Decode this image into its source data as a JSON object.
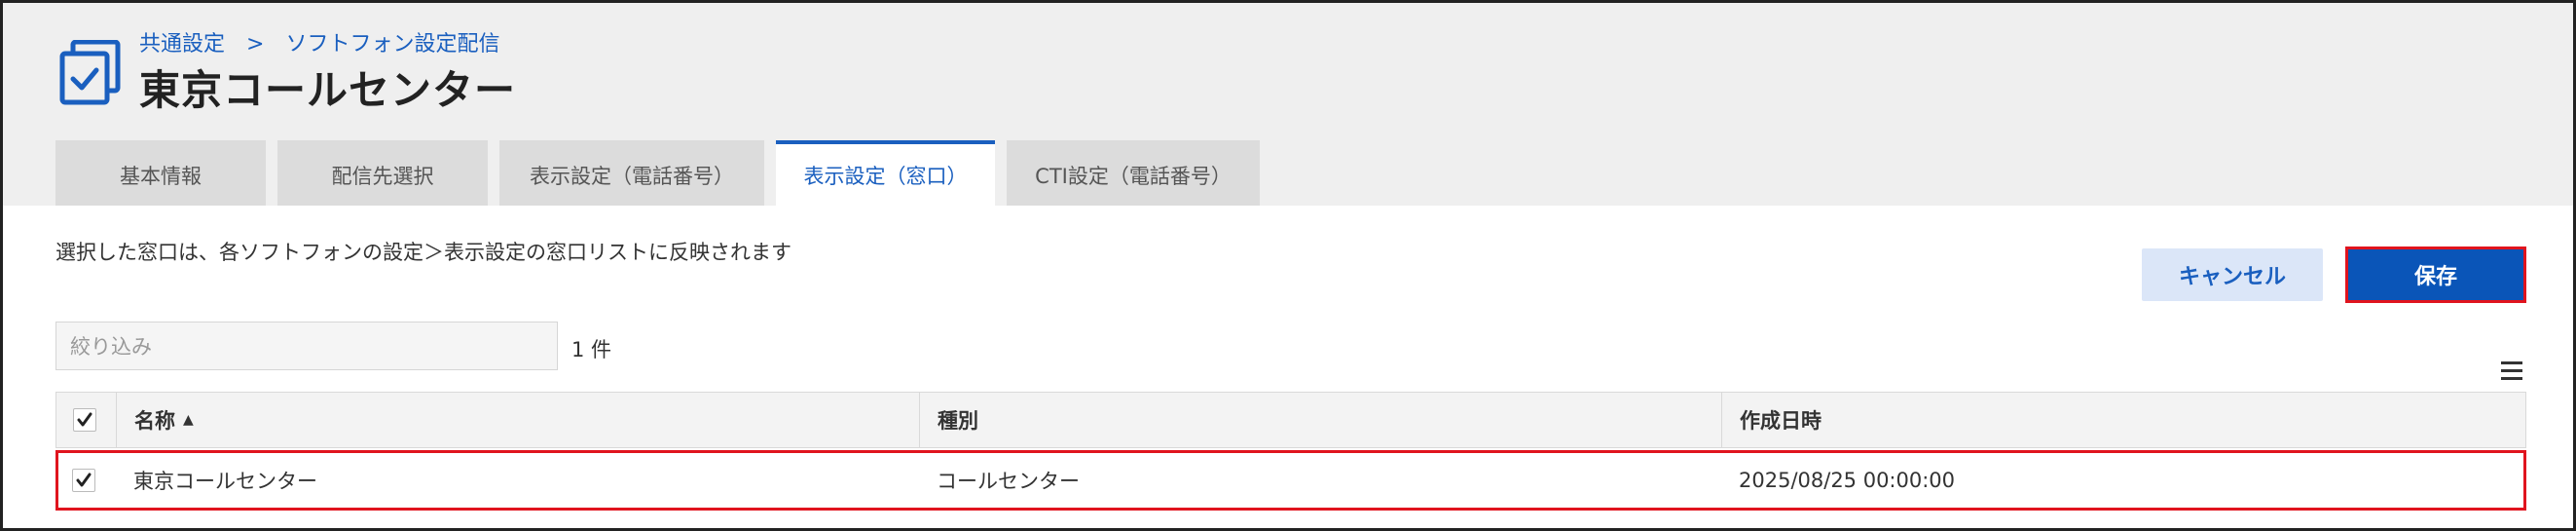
{
  "header": {
    "breadcrumb": {
      "parent": "共通設定",
      "separator": ">",
      "current": "ソフトフォン設定配信"
    },
    "title": "東京コールセンター",
    "icon": "clipboard-check-icon"
  },
  "tabs": [
    {
      "label": "基本情報",
      "active": false
    },
    {
      "label": "配信先選択",
      "active": false
    },
    {
      "label": "表示設定（電話番号）",
      "active": false
    },
    {
      "label": "表示設定（窓口）",
      "active": true
    },
    {
      "label": "CTI設定（電話番号）",
      "active": false
    }
  ],
  "content": {
    "description": "選択した窓口は、各ソフトフォンの設定＞表示設定の窓口リストに反映されます",
    "cancel_label": "キャンセル",
    "save_label": "保存",
    "filter_placeholder": "絞り込み",
    "count_text": "1 件"
  },
  "table": {
    "columns": [
      {
        "label": "名称",
        "sort": "▲"
      },
      {
        "label": "種別"
      },
      {
        "label": "作成日時"
      }
    ],
    "rows": [
      {
        "checked": true,
        "name": "東京コールセンター",
        "type": "コールセンター",
        "created": "2025/08/25 00:00:00"
      }
    ]
  },
  "colors": {
    "accent": "#1a5fbf",
    "save_bg": "#0a55b8",
    "highlight": "#e0141e"
  }
}
